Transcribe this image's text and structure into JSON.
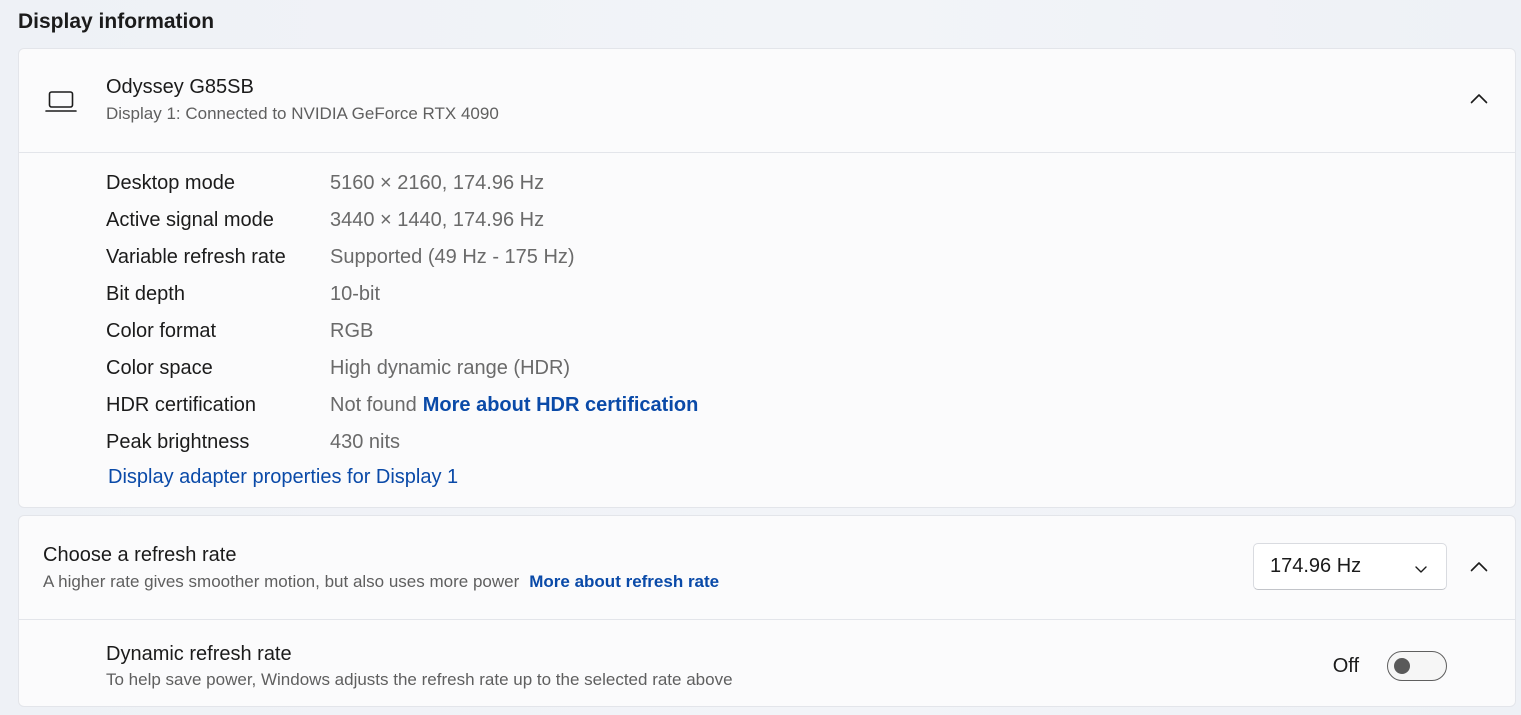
{
  "section_title": "Display information",
  "display": {
    "name": "Odyssey G85SB",
    "subtitle": "Display 1: Connected to NVIDIA GeForce RTX 4090",
    "details": [
      {
        "label": "Desktop mode",
        "value": "5160 × 2160, 174.96 Hz"
      },
      {
        "label": "Active signal mode",
        "value": "3440 × 1440, 174.96 Hz"
      },
      {
        "label": "Variable refresh rate",
        "value": "Supported (49 Hz - 175 Hz)"
      },
      {
        "label": "Bit depth",
        "value": "10-bit"
      },
      {
        "label": "Color format",
        "value": "RGB"
      },
      {
        "label": "Color space",
        "value": "High dynamic range (HDR)"
      },
      {
        "label": "HDR certification",
        "value": "Not found",
        "link": "More about HDR certification"
      },
      {
        "label": "Peak brightness",
        "value": "430 nits"
      }
    ],
    "adapter_link": "Display adapter properties for Display 1"
  },
  "refresh": {
    "title": "Choose a refresh rate",
    "subtitle": "A higher rate gives smoother motion, but also uses more power",
    "link": "More about refresh rate",
    "selected": "174.96 Hz"
  },
  "dynamic": {
    "title": "Dynamic refresh rate",
    "subtitle": "To help save power, Windows adjusts the refresh rate up to the selected rate above",
    "state": "Off",
    "enabled": false
  },
  "colors": {
    "link": "#0a4aa8",
    "card_bg": "#fbfbfc",
    "page_bg": "#eef1f6"
  },
  "icons": {
    "display": "laptop-icon",
    "expand": "chevron-up-icon",
    "dropdown": "chevron-down-icon"
  }
}
